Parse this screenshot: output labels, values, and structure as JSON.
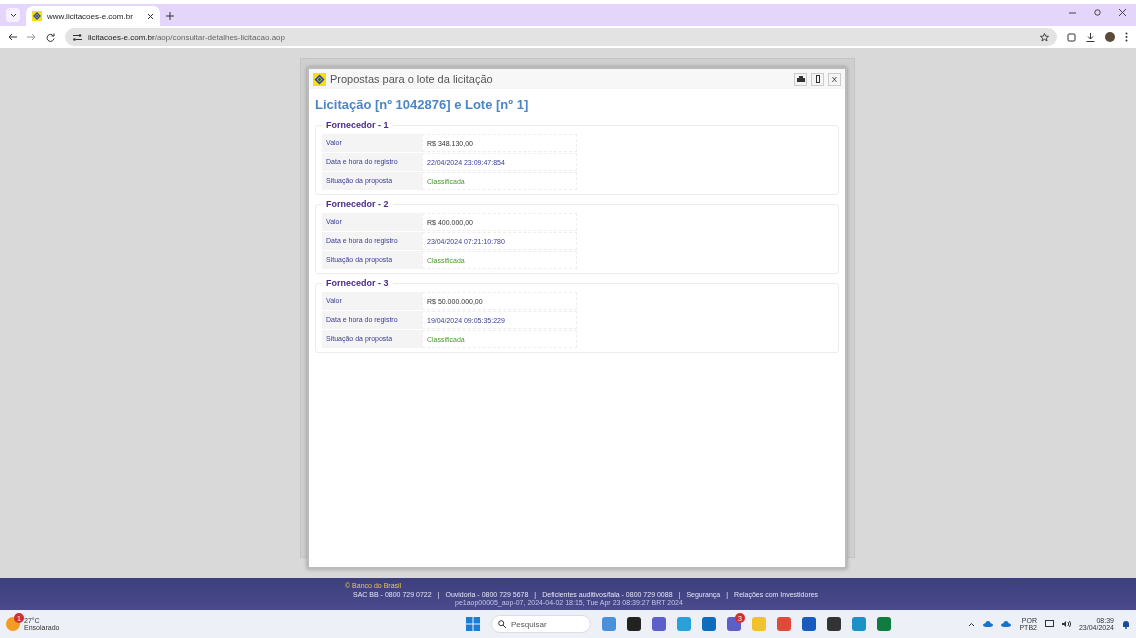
{
  "browser": {
    "tab": {
      "title": "www.licitacoes-e.com.br",
      "selected": true
    },
    "url_host": "licitacoes-e.com.br",
    "url_path": "/aop/consultar-detalhes-licitacao.aop"
  },
  "modal": {
    "title": "Propostas para o lote da licitação",
    "close_label": "X",
    "heading": "Licitação [nº 1042876] e Lote [nº 1]",
    "suppliers": [
      {
        "legend": "Fornecedor - 1",
        "rows": [
          {
            "label": "Valor",
            "value": "R$ 348.130,00",
            "kind": "amount"
          },
          {
            "label": "Data e hora do registro",
            "value": "22/04/2024 23:09:47:854",
            "kind": "date"
          },
          {
            "label": "Situação da proposta",
            "value": "Classificada",
            "kind": "status"
          }
        ]
      },
      {
        "legend": "Fornecedor - 2",
        "rows": [
          {
            "label": "Valor",
            "value": "R$ 400.000,00",
            "kind": "amount"
          },
          {
            "label": "Data e hora do registro",
            "value": "23/04/2024 07:21:10:780",
            "kind": "date"
          },
          {
            "label": "Situação da proposta",
            "value": "Classificada",
            "kind": "status"
          }
        ]
      },
      {
        "legend": "Fornecedor - 3",
        "rows": [
          {
            "label": "Valor",
            "value": "R$ 50.000.000,00",
            "kind": "amount"
          },
          {
            "label": "Data e hora do registro",
            "value": "19/04/2024 09:05:35:229",
            "kind": "date"
          },
          {
            "label": "Situação da proposta",
            "value": "Classificada",
            "kind": "status"
          }
        ]
      }
    ]
  },
  "footer": {
    "copyright": "© Banco do Brasil",
    "links": [
      "SAC BB - 0800 729 0722",
      "Ouvidoria - 0800 729 5678",
      "Deficientes auditivos/fala - 0800 729 0088",
      "Segurança",
      "Relações com Investidores"
    ],
    "separator": "|",
    "build": "pe1aop00005_aop-07, 2024-04-02 18:15, Tue Apr 23 08:39:27 BRT 2024"
  },
  "taskbar": {
    "weather": {
      "temp": "27°C",
      "desc": "Ensolarado",
      "badge": "1"
    },
    "search_placeholder": "Pesquisar",
    "teams_badge": "3",
    "language": "POR",
    "layout": "PTB2",
    "time": "08:39",
    "date": "23/04/2024"
  }
}
